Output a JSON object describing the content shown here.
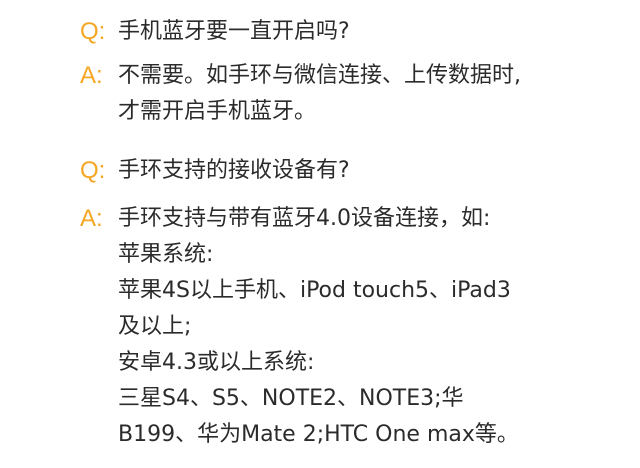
{
  "faq": {
    "colors": {
      "marker": "#f5a623",
      "text": "#2b2b2b",
      "background": "#ffffff"
    },
    "items": [
      {
        "q_marker": "Q:",
        "question": "手机蓝牙要一直开启吗?",
        "a_marker": "A:",
        "answer_lines": [
          "不需要。如手环与微信连接、上传数据时,",
          "才需开启手机蓝牙。"
        ]
      },
      {
        "q_marker": "Q:",
        "question": "手环支持的接收设备有?",
        "a_marker": "A:",
        "answer_lines": [
          "手环支持与带有蓝牙4.0设备连接，如:",
          "苹果系统:",
          "苹果4S以上手机、iPod touch5、iPad3",
          "及以上;",
          "安卓4.3或以上系统:",
          "三星S4、S5、NOTE2、NOTE3;华",
          "B199、华为Mate 2;HTC One max等。"
        ]
      }
    ]
  }
}
